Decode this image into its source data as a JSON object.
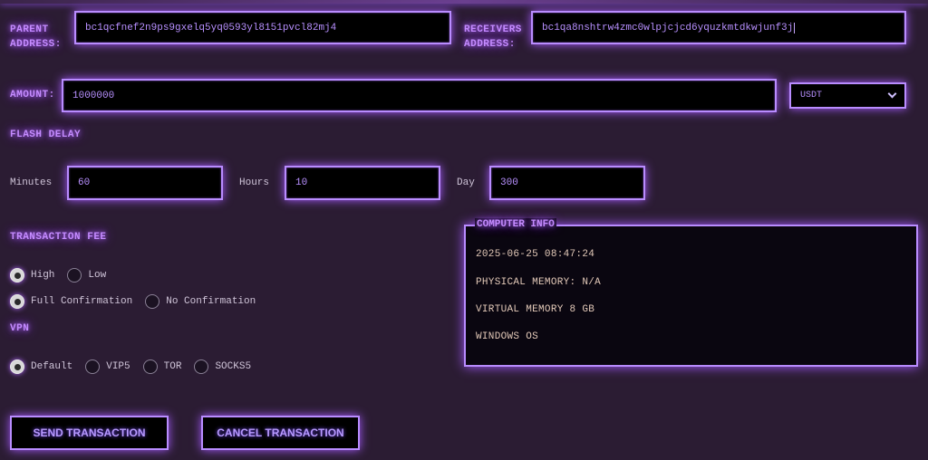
{
  "form": {
    "parent_label_line1": "PARENT",
    "parent_label_line2": "ADDRESS:",
    "parent_address": "bc1qcfnef2n9ps9gxelq5yq0593yl8151pvcl82mj4",
    "receivers_label_line1": "RECEIVERS",
    "receivers_label_line2": "ADDRESS:",
    "receivers_address": "bc1qa8nshtrw4zmc0wlpjcjcd6yquzkmtdkwjunf3j",
    "amount_label": "AMOUNT:",
    "amount_value": "1000000",
    "currency_selected": "USDT"
  },
  "flash_delay": {
    "title": "FLASH DELAY",
    "minutes_label": "Minutes",
    "minutes_value": "60",
    "hours_label": "Hours",
    "hours_value": "10",
    "day_label": "Day",
    "day_value": "300"
  },
  "transaction_fee": {
    "title": "TRANSACTION FEE",
    "fee_options": [
      {
        "label": "High",
        "checked": true
      },
      {
        "label": "Low",
        "checked": false
      }
    ],
    "confirm_options": [
      {
        "label": "Full Confirmation",
        "checked": true
      },
      {
        "label": "No Confirmation",
        "checked": false
      }
    ]
  },
  "vpn": {
    "title": "VPN",
    "options": [
      {
        "label": "Default",
        "checked": true
      },
      {
        "label": "VIP5",
        "checked": false
      },
      {
        "label": "TOR",
        "checked": false
      },
      {
        "label": "SOCKS5",
        "checked": false
      }
    ]
  },
  "computer_info": {
    "title": "COMPUTER INFO",
    "datetime": "2025-06-25 08:47:24",
    "physical_memory": "PHYSICAL MEMORY: N/A",
    "virtual_memory": "VIRTUAL MEMORY 8 GB",
    "os": "WINDOWS OS"
  },
  "buttons": {
    "send": "SEND TRANSACTION",
    "cancel": "CANCEL TRANSACTION"
  },
  "colors": {
    "background": "#2b1c33",
    "accent": "#b98cff",
    "glow": "#a65bff"
  }
}
